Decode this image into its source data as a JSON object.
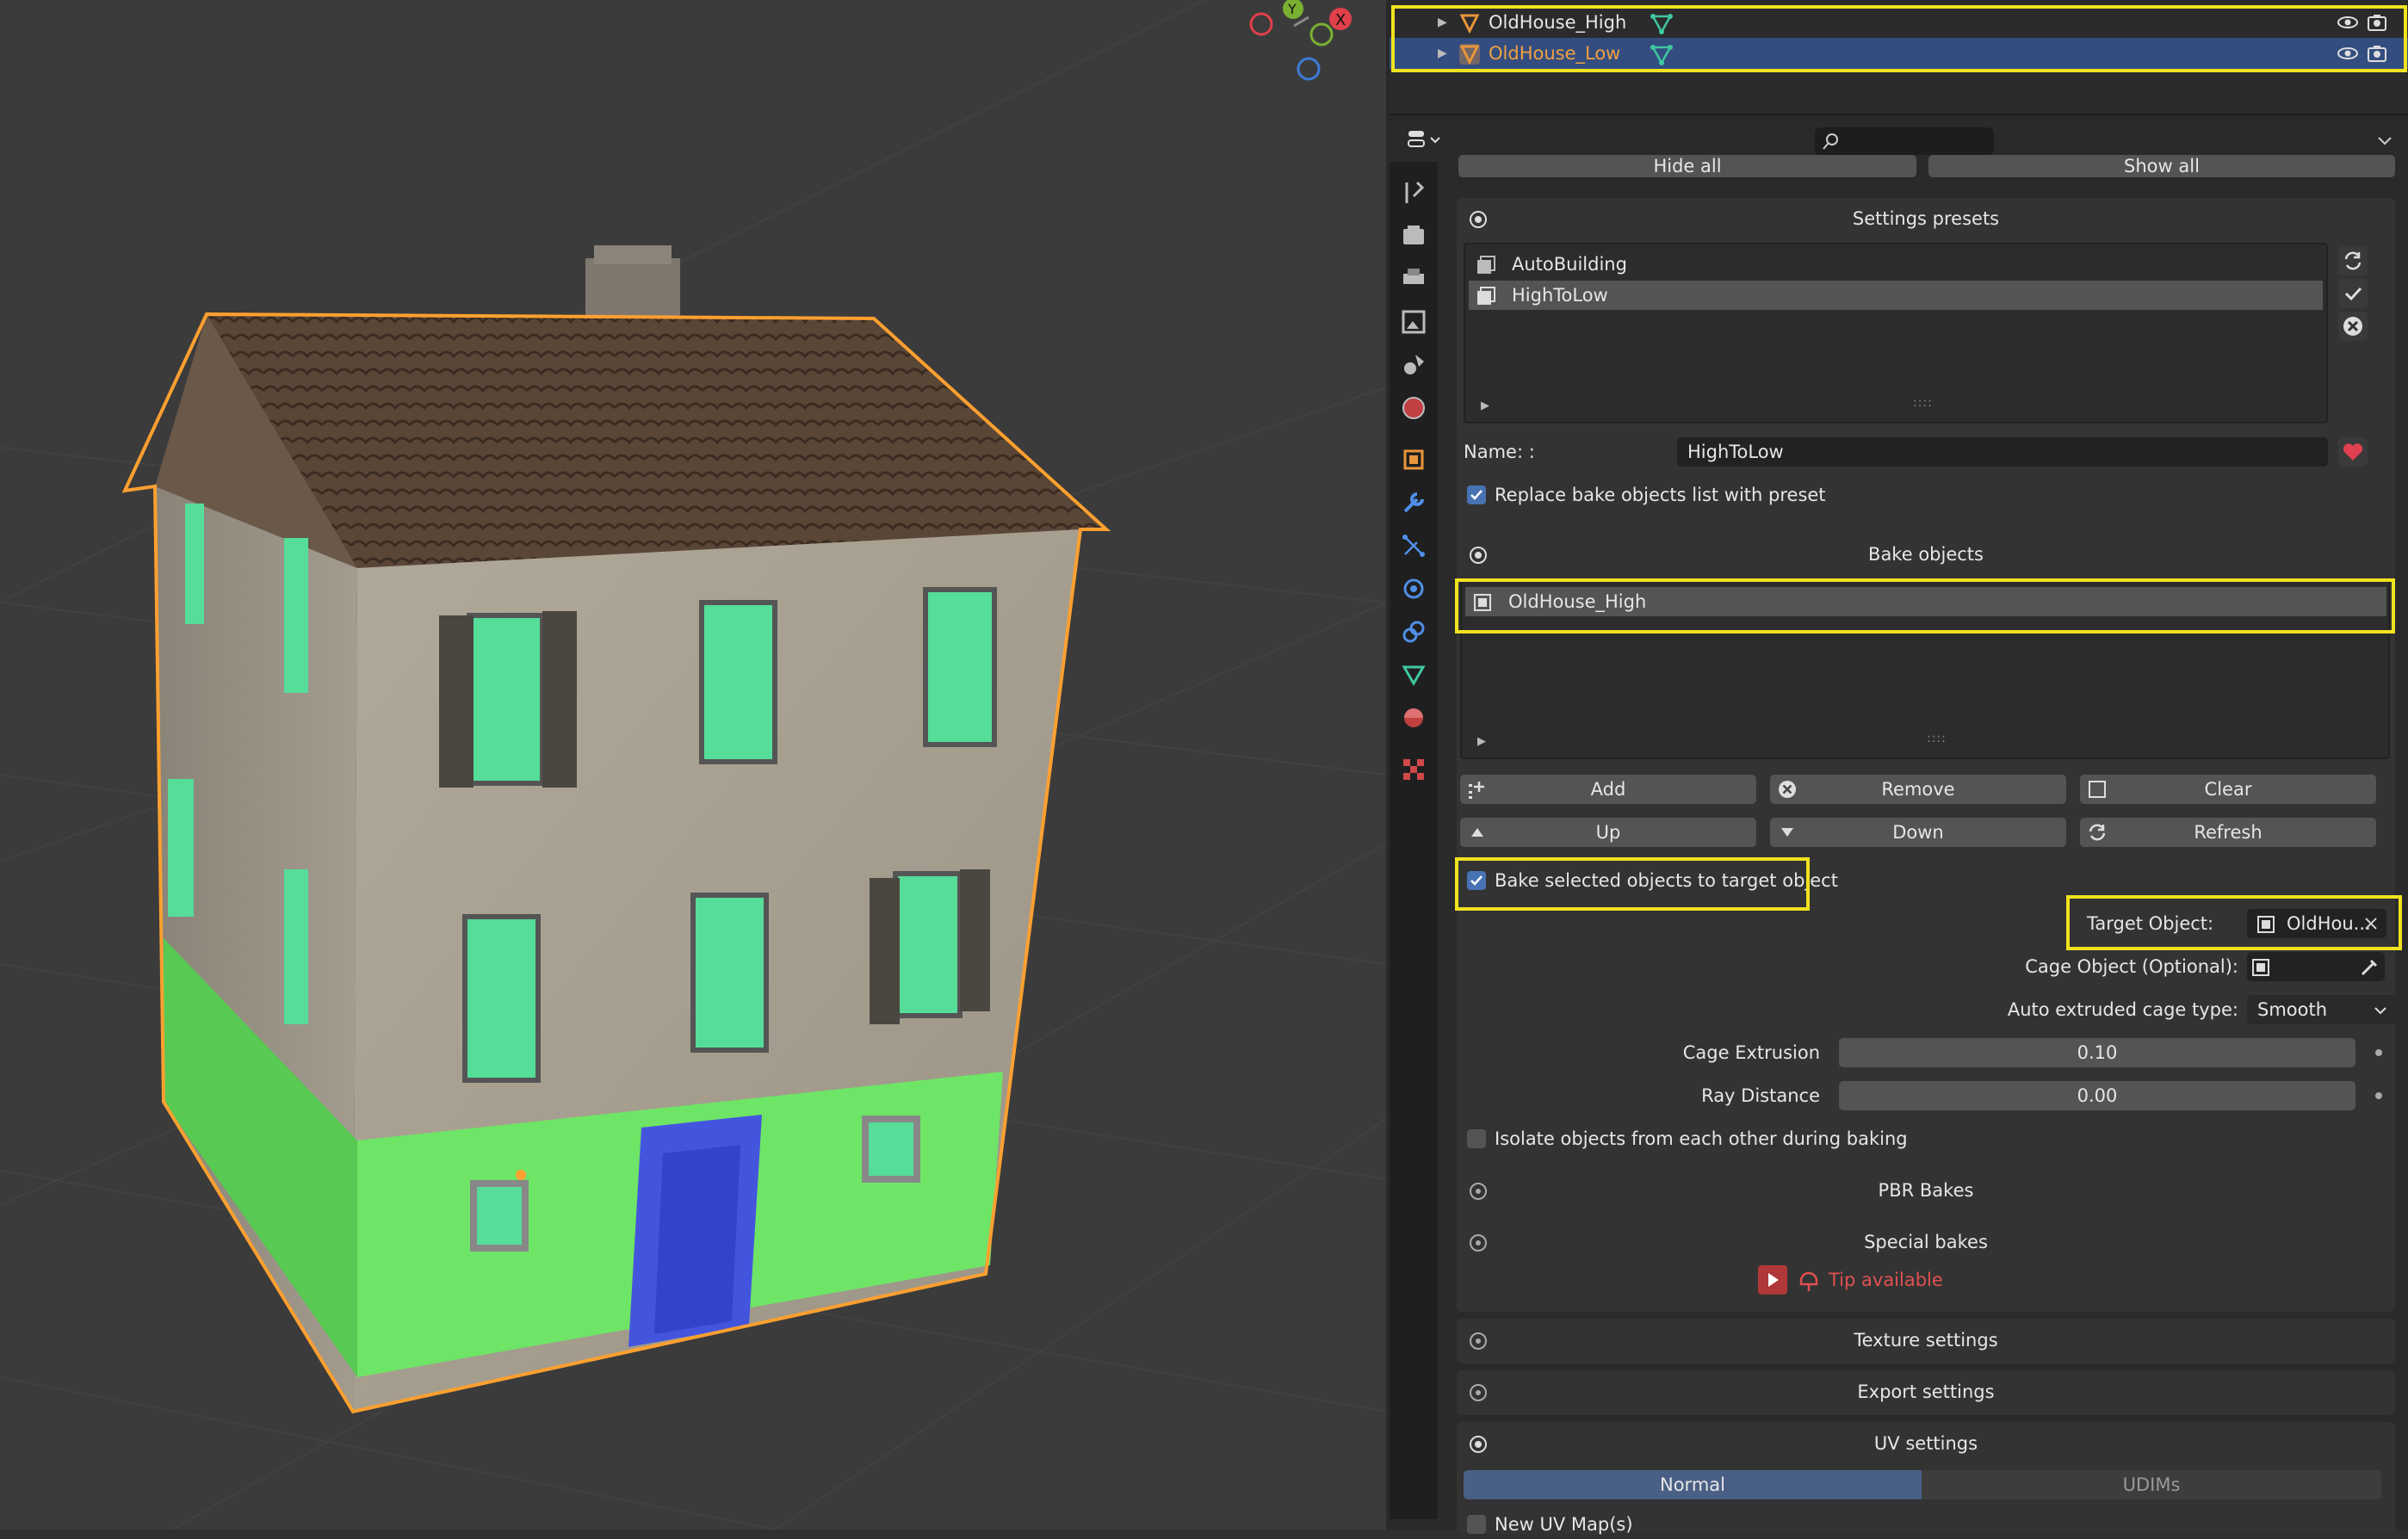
{
  "outliner": {
    "rows": [
      {
        "name": "OldHouse_High",
        "selected": false
      },
      {
        "name": "OldHouse_Low",
        "selected": true
      }
    ]
  },
  "toolbar": {
    "hide_all": "Hide all",
    "show_all": "Show all"
  },
  "presets": {
    "title": "Settings presets",
    "items": [
      "AutoBuilding",
      "HighToLow"
    ],
    "selected_index": 1,
    "name_label": "Name: :",
    "name_value": "HighToLow",
    "replace_label": "Replace bake objects list with preset"
  },
  "bake_objects": {
    "title": "Bake objects",
    "items": [
      "OldHouse_High"
    ],
    "add": "Add",
    "remove": "Remove",
    "clear": "Clear",
    "up": "Up",
    "down": "Down",
    "refresh": "Refresh",
    "bake_selected_label": "Bake selected objects to target object",
    "target_label": "Target Object:",
    "target_value": "OldHou...",
    "cage_label": "Cage Object (Optional):",
    "cage_type_label": "Auto extruded cage type:",
    "cage_type_value": "Smooth",
    "cage_extrusion_label": "Cage Extrusion",
    "cage_extrusion_value": "0.10",
    "ray_distance_label": "Ray Distance",
    "ray_distance_value": "0.00",
    "isolate_label": "Isolate objects from each other during baking"
  },
  "sections": {
    "pbr": "PBR Bakes",
    "special": "Special bakes",
    "tip": "Tip available",
    "texture": "Texture settings",
    "export": "Export settings",
    "uv": "UV settings",
    "uv_normal": "Normal",
    "uv_udims": "UDIMs",
    "new_uv": "New UV Map(s)"
  },
  "colors": {
    "accent": "#4772b3",
    "highlight": "#f0e21e",
    "selection_outline": "#ffa030",
    "tip_red": "#e05050"
  },
  "gizmo": {
    "x_label": "X",
    "y_label": "Y"
  }
}
